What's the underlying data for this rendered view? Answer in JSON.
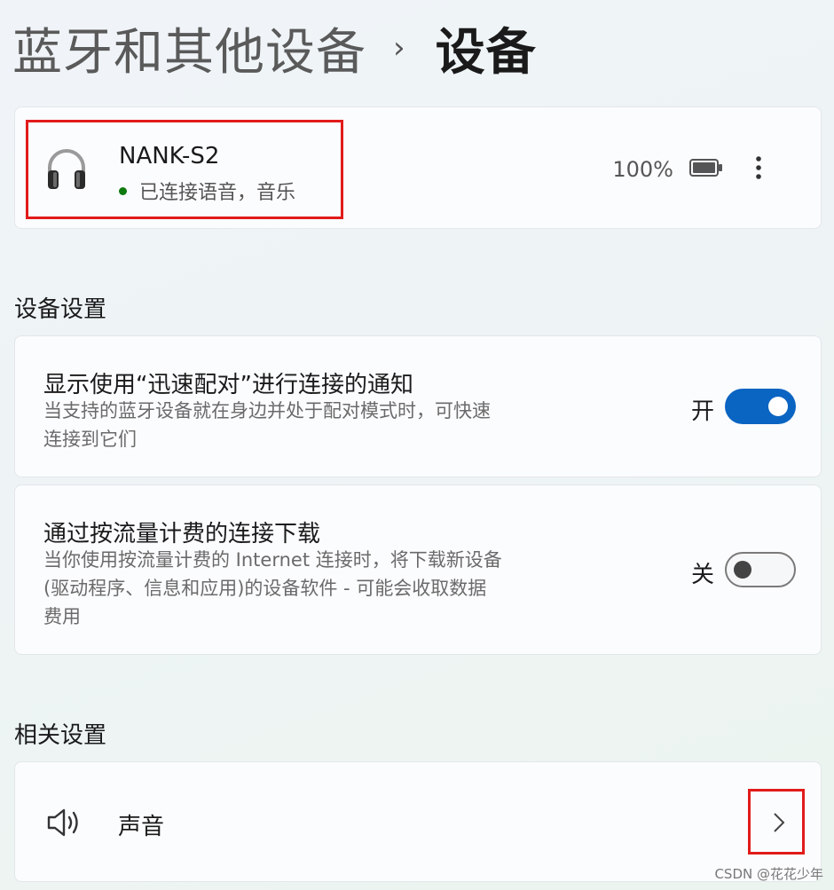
{
  "breadcrumb": {
    "parent": "蓝牙和其他设备",
    "separator": "›",
    "current": "设备"
  },
  "device": {
    "name": "NANK-S2",
    "status": "已连接语音，音乐",
    "battery": "100%",
    "icon": "headphones-icon"
  },
  "device_settings": {
    "title": "设备设置",
    "items": [
      {
        "title": "显示使用“迅速配对”进行连接的通知",
        "description": "当支持的蓝牙设备就在身边并处于配对模式时，可快速连接到它们",
        "state_label": "开",
        "on": true
      },
      {
        "title": "通过按流量计费的连接下载",
        "description": "当你使用按流量计费的 Internet 连接时，将下载新设备(驱动程序、信息和应用)的设备软件 - 可能会收取数据费用",
        "state_label": "关",
        "on": false
      }
    ]
  },
  "related_settings": {
    "title": "相关设置",
    "items": [
      {
        "label": "声音",
        "icon": "speaker-icon"
      }
    ]
  },
  "watermark": "CSDN @花花少年",
  "colors": {
    "accent": "#0a64c2",
    "highlight": "#e21b1b",
    "status_connected": "#0f7b0f"
  }
}
